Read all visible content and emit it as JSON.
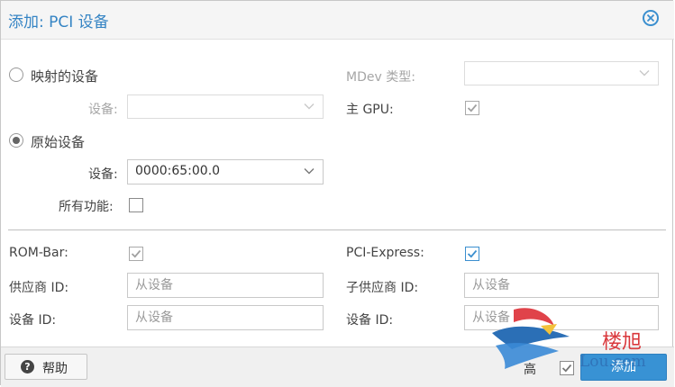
{
  "dialog": {
    "title": "添加: PCI 设备"
  },
  "mapped": {
    "radio_label": "映射的设备",
    "device_label": "设备:"
  },
  "mdev": {
    "label": "MDev 类型:"
  },
  "primary_gpu": {
    "label": "主 GPU:"
  },
  "raw": {
    "radio_label": "原始设备",
    "device_label": "设备:",
    "device_value": "0000:65:00.0",
    "all_functions_label": "所有功能:"
  },
  "advanced": {
    "rom_bar_label": "ROM-Bar:",
    "pci_express_label": "PCI-Express:",
    "vendor_id_label": "供应商 ID:",
    "vendor_id_placeholder": "从设备",
    "sub_vendor_id_label": "子供应商 ID:",
    "sub_vendor_id_placeholder": "从设备",
    "device_id_label": "设备 ID:",
    "device_id_placeholder": "从设备",
    "sub_device_id_label": "设备 ID:",
    "sub_device_id_placeholder": "从设备"
  },
  "footer": {
    "help_label": "帮助",
    "advanced_label": "高",
    "add_label": "添加"
  },
  "watermark": {
    "text1": "楼旭",
    "text2": "Lou.com"
  },
  "colors": {
    "accent": "#3892d4",
    "title": "#3584c4"
  }
}
